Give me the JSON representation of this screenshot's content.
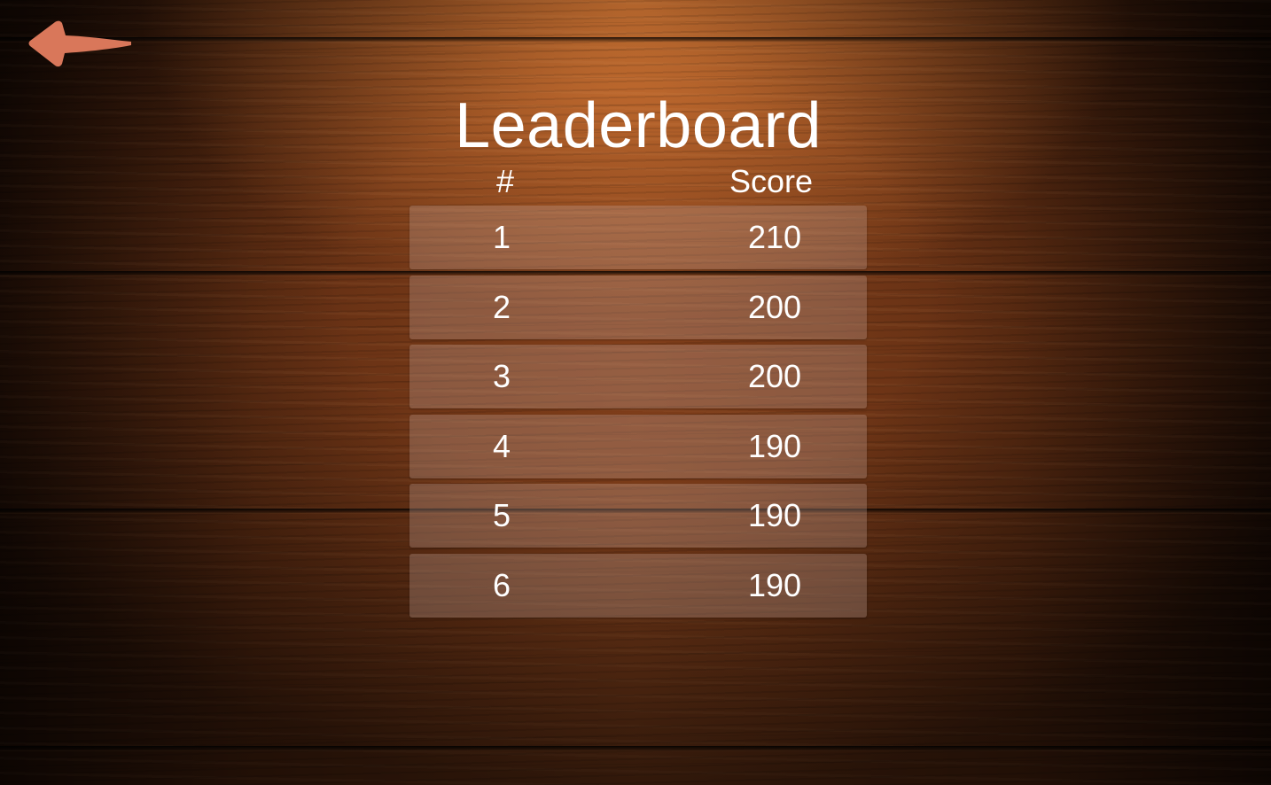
{
  "screen": {
    "title": "Leaderboard"
  },
  "back_button": {
    "icon": "arrow-left-icon",
    "color": "#d9775a"
  },
  "table": {
    "headers": {
      "rank": "#",
      "score": "Score"
    },
    "rows": [
      {
        "rank": "1",
        "score": "210"
      },
      {
        "rank": "2",
        "score": "200"
      },
      {
        "rank": "3",
        "score": "200"
      },
      {
        "rank": "4",
        "score": "190"
      },
      {
        "rank": "5",
        "score": "190"
      },
      {
        "rank": "6",
        "score": "190"
      }
    ]
  },
  "colors": {
    "text": "#ffffff",
    "row_fill": "rgba(200,170,160,0.30)",
    "wood_light": "#e8843a",
    "wood_dark": "#1c0c05"
  }
}
